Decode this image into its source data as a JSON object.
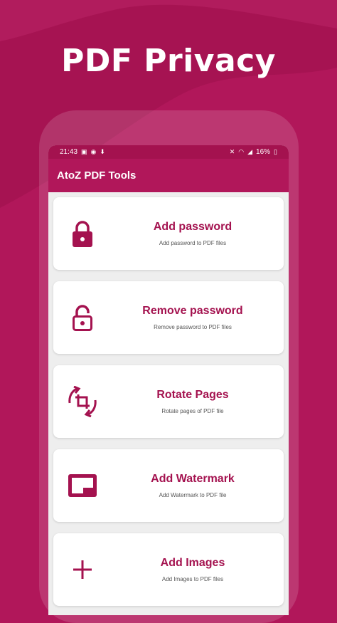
{
  "promo": {
    "title": "PDF Privacy"
  },
  "status_bar": {
    "time": "21:43",
    "battery": "16%"
  },
  "app_bar": {
    "title": "AtoZ PDF Tools"
  },
  "tools": [
    {
      "title": "Add password",
      "subtitle": "Add password to PDF files",
      "icon": "lock-icon"
    },
    {
      "title": "Remove password",
      "subtitle": "Remove password to PDF files",
      "icon": "unlock-icon"
    },
    {
      "title": "Rotate Pages",
      "subtitle": "Rotate pages of PDF file",
      "icon": "rotate-icon"
    },
    {
      "title": "Add Watermark",
      "subtitle": "Add Watermark to PDF file",
      "icon": "watermark-icon"
    },
    {
      "title": "Add Images",
      "subtitle": "Add Images to PDF files",
      "icon": "plus-icon"
    }
  ],
  "colors": {
    "brand": "#b1175a",
    "brand_dark": "#a4124f",
    "screen_bg": "#eeeeee"
  }
}
